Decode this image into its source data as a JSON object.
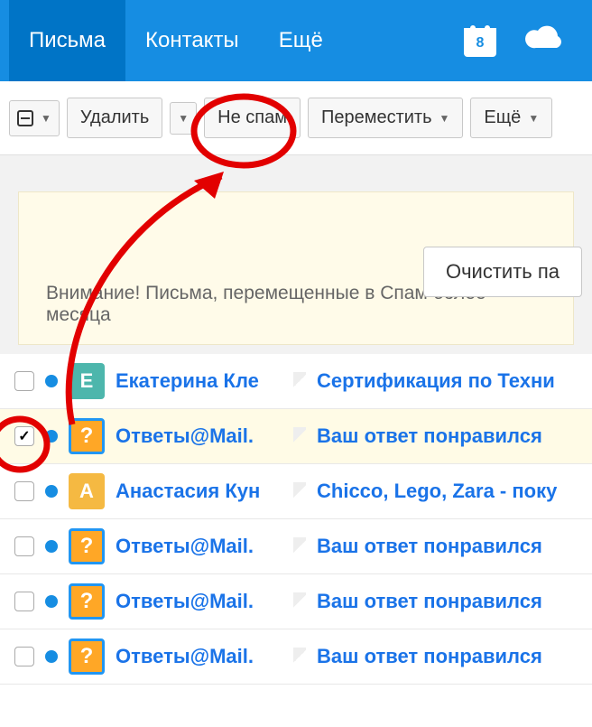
{
  "nav": {
    "tabs": [
      "Письма",
      "Контакты",
      "Ещё"
    ],
    "calendar_day": "8"
  },
  "toolbar": {
    "delete": "Удалить",
    "not_spam": "Не спам",
    "move": "Переместить",
    "more": "Ещё"
  },
  "banner": {
    "clear": "Очистить па",
    "warning": "Внимание! Письма, перемещенные в Спам более месяца"
  },
  "rows": [
    {
      "checked": false,
      "avatar_type": "teal",
      "avatar_letter": "Е",
      "sender": "Екатерина Кле",
      "subject": "Сертификация по Техни"
    },
    {
      "checked": true,
      "avatar_type": "q",
      "avatar_letter": "",
      "sender": "Ответы@Mail.",
      "subject": "Ваш ответ понравился"
    },
    {
      "checked": false,
      "avatar_type": "yellow",
      "avatar_letter": "А",
      "sender": "Анастасия Кун",
      "subject": "Chicco, Lego, Zara - поку"
    },
    {
      "checked": false,
      "avatar_type": "q",
      "avatar_letter": "",
      "sender": "Ответы@Mail.",
      "subject": "Ваш ответ понравился"
    },
    {
      "checked": false,
      "avatar_type": "q",
      "avatar_letter": "",
      "sender": "Ответы@Mail.",
      "subject": "Ваш ответ понравился"
    },
    {
      "checked": false,
      "avatar_type": "q",
      "avatar_letter": "",
      "sender": "Ответы@Mail.",
      "subject": "Ваш ответ понравился"
    }
  ]
}
